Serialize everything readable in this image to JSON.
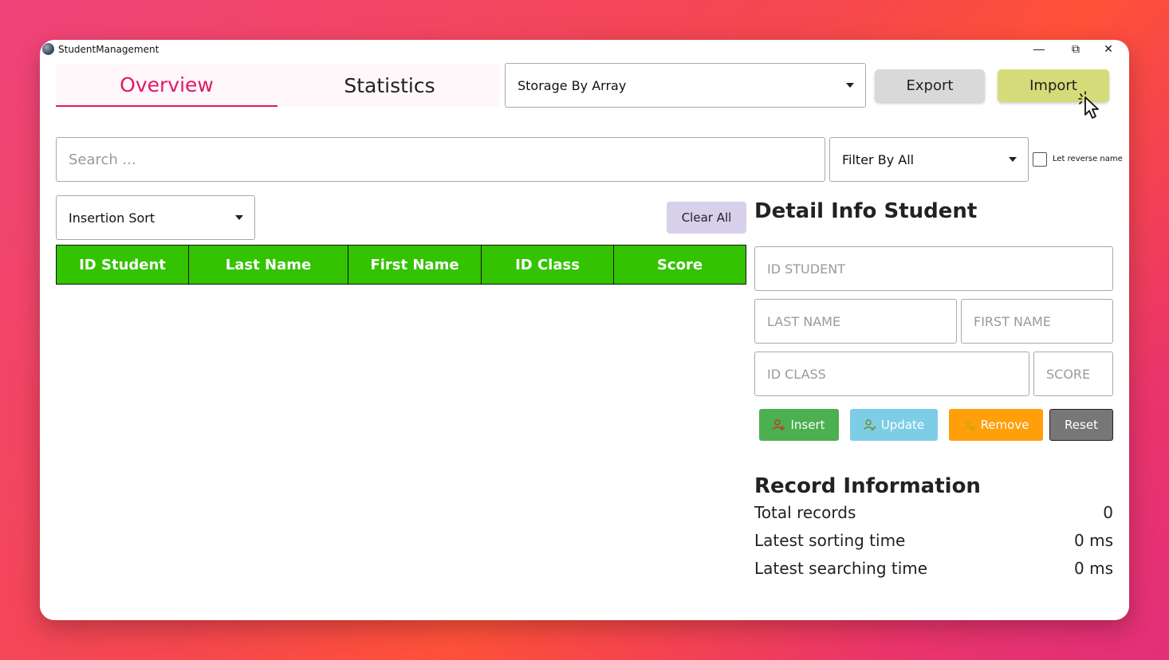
{
  "window": {
    "title": "StudentManagement"
  },
  "window_controls": {
    "minimize": "—",
    "maximize": "⧉",
    "close": "✕"
  },
  "tabs": [
    {
      "label": "Overview",
      "active": true
    },
    {
      "label": "Statistics",
      "active": false
    }
  ],
  "storage": {
    "selected": "Storage By Array"
  },
  "toolbar": {
    "export_label": "Export",
    "import_label": "Import"
  },
  "search": {
    "placeholder": "Search ...",
    "value": ""
  },
  "filter": {
    "selected": "Filter By All"
  },
  "reverse_name": {
    "label": "Let reverse name",
    "checked": false
  },
  "sort": {
    "selected": "Insertion Sort"
  },
  "clear_all_label": "Clear All",
  "table": {
    "columns": [
      "ID Student",
      "Last Name",
      "First Name",
      "ID Class",
      "Score"
    ],
    "rows": []
  },
  "detail": {
    "title": "Detail Info Student",
    "id_student_placeholder": "ID STUDENT",
    "last_name_placeholder": "LAST NAME",
    "first_name_placeholder": "FIRST NAME",
    "id_class_placeholder": "ID CLASS",
    "score_placeholder": "SCORE"
  },
  "actions": {
    "insert_label": "Insert",
    "update_label": "Update",
    "remove_label": "Remove",
    "reset_label": "Reset"
  },
  "record": {
    "title": "Record Information",
    "total_records_label": "Total records",
    "total_records_value": "0",
    "sorting_time_label": "Latest sorting time",
    "sorting_time_value": "0 ms",
    "searching_time_label": "Latest searching time",
    "searching_time_value": "0 ms"
  },
  "colors": {
    "accent": "#e0196a",
    "table_header": "#33c300",
    "insert": "#4caf50",
    "update": "#7ecde6",
    "remove": "#ff9f0a",
    "reset": "#777777",
    "import": "#d6db7a",
    "export": "#d9d9d9",
    "clear_all": "#d8d0ea"
  }
}
